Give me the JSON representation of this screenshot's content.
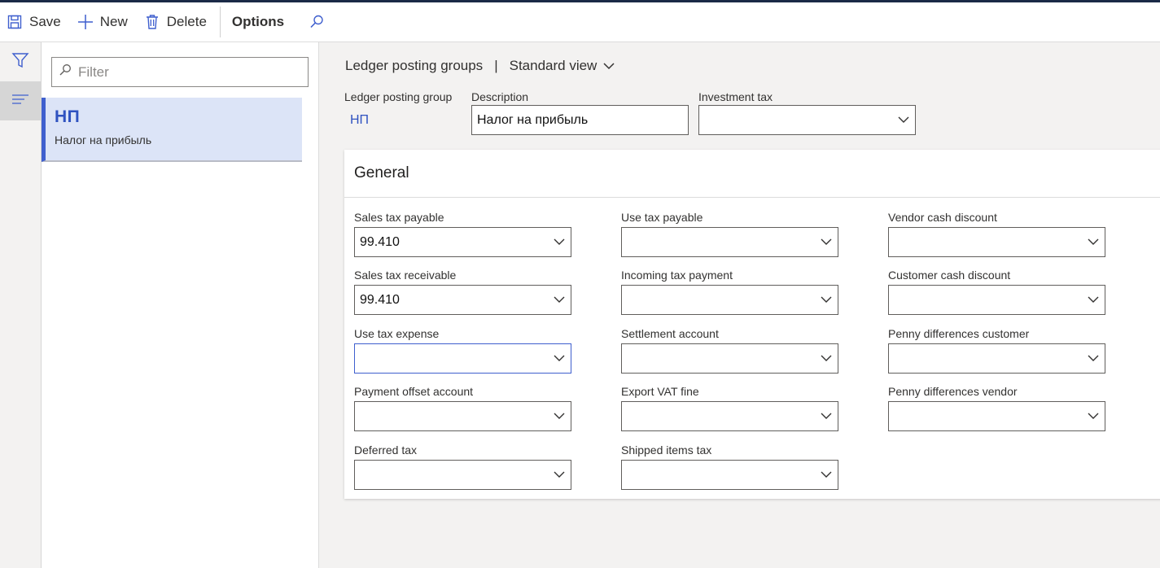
{
  "toolbar": {
    "save_label": "Save",
    "new_label": "New",
    "delete_label": "Delete",
    "options_label": "Options"
  },
  "rail": {
    "filter_icon": "filter-icon",
    "list_icon": "list-icon"
  },
  "list": {
    "filter_placeholder": "Filter",
    "items": [
      {
        "code": "НП",
        "description": "Налог на прибыль"
      }
    ]
  },
  "header": {
    "breadcrumb_title": "Ledger posting groups",
    "separator": "|",
    "view_label": "Standard view"
  },
  "form": {
    "ledger_posting_group_label": "Ledger posting group",
    "ledger_posting_group_value": "НП",
    "description_label": "Description",
    "description_value": "Налог на прибыль",
    "investment_tax_label": "Investment tax",
    "investment_tax_value": ""
  },
  "general": {
    "title": "General",
    "fields": [
      {
        "label": "Sales tax payable",
        "value": "99.410"
      },
      {
        "label": "Sales tax receivable",
        "value": "99.410"
      },
      {
        "label": "Use tax expense",
        "value": ""
      },
      {
        "label": "Payment offset account",
        "value": ""
      },
      {
        "label": "Deferred tax",
        "value": ""
      },
      {
        "label": "Use tax payable",
        "value": ""
      },
      {
        "label": "Incoming tax payment",
        "value": ""
      },
      {
        "label": "Settlement account",
        "value": ""
      },
      {
        "label": "Export VAT fine",
        "value": ""
      },
      {
        "label": "Shipped items tax",
        "value": ""
      },
      {
        "label": "Vendor cash discount",
        "value": ""
      },
      {
        "label": "Customer cash discount",
        "value": ""
      },
      {
        "label": "Penny differences customer",
        "value": ""
      },
      {
        "label": "Penny differences vendor",
        "value": ""
      }
    ]
  },
  "colors": {
    "accent": "#3f5fce",
    "selected_bg": "#dce4f7",
    "page_bg": "#f3f2f1"
  }
}
